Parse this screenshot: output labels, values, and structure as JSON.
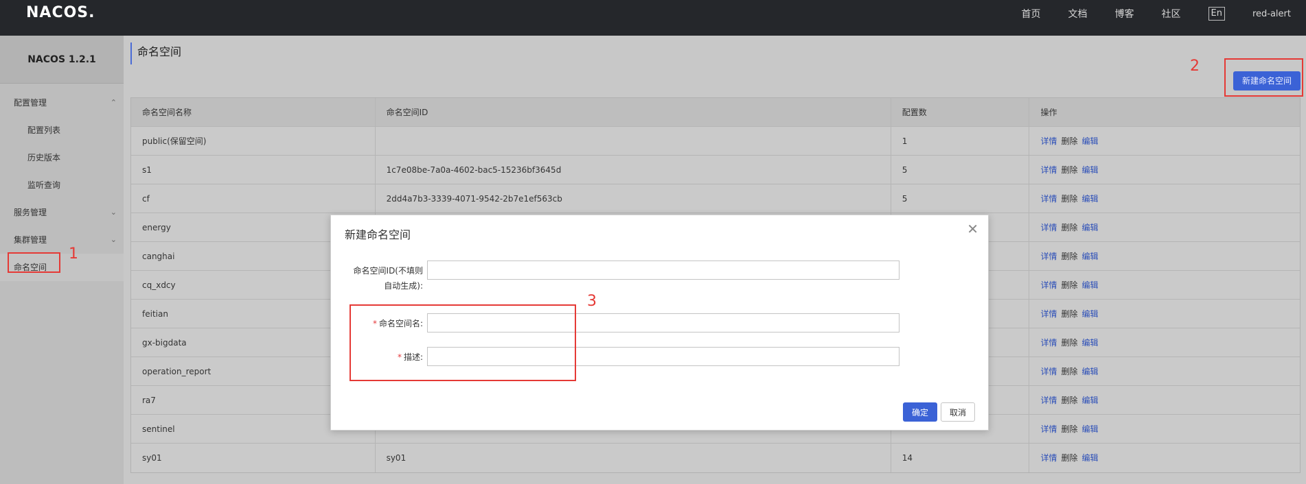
{
  "header": {
    "logo": "NACOS.",
    "nav": [
      "首页",
      "文档",
      "博客",
      "社区"
    ],
    "lang": "En",
    "user": "red-alert"
  },
  "sidebar": {
    "title": "NACOS 1.2.1",
    "items": [
      {
        "label": "配置管理",
        "type": "group",
        "chevron": "up"
      },
      {
        "label": "配置列表",
        "type": "sub"
      },
      {
        "label": "历史版本",
        "type": "sub"
      },
      {
        "label": "监听查询",
        "type": "sub"
      },
      {
        "label": "服务管理",
        "type": "group",
        "chevron": "down"
      },
      {
        "label": "集群管理",
        "type": "group",
        "chevron": "down"
      },
      {
        "label": "命名空间",
        "type": "item",
        "active": true
      }
    ]
  },
  "main": {
    "title": "命名空间",
    "new_button": "新建命名空间",
    "table": {
      "headers": [
        "命名空间名称",
        "命名空间ID",
        "配置数",
        "操作"
      ],
      "ops": [
        "详情",
        "删除",
        "编辑"
      ],
      "rows": [
        {
          "name": "public(保留空间)",
          "id": "",
          "count": "1"
        },
        {
          "name": "s1",
          "id": "1c7e08be-7a0a-4602-bac5-15236bf3645d",
          "count": "5"
        },
        {
          "name": "cf",
          "id": "2dd4a7b3-3339-4071-9542-2b7e1ef563cb",
          "count": "5"
        },
        {
          "name": "energy",
          "id": "",
          "count": ""
        },
        {
          "name": "canghai",
          "id": "",
          "count": ""
        },
        {
          "name": "cq_xdcy",
          "id": "",
          "count": ""
        },
        {
          "name": "feitian",
          "id": "",
          "count": ""
        },
        {
          "name": "gx-bigdata",
          "id": "",
          "count": ""
        },
        {
          "name": "operation_report",
          "id": "",
          "count": ""
        },
        {
          "name": "ra7",
          "id": "",
          "count": ""
        },
        {
          "name": "sentinel",
          "id": "",
          "count": ""
        },
        {
          "name": "sy01",
          "id": "sy01",
          "count": "14"
        }
      ]
    }
  },
  "dialog": {
    "title": "新建命名空间",
    "fields": {
      "id_label_line1": "命名空间ID(不填则",
      "id_label_line2": "自动生成):",
      "name_label": "命名空间名:",
      "desc_label": "描述:",
      "required_mark": "*"
    },
    "ok": "确定",
    "cancel": "取消"
  },
  "annotations": [
    "1",
    "2",
    "3"
  ],
  "colors": {
    "accent": "#3b62d6",
    "annotation": "#e53935",
    "topbar": "#25272b"
  }
}
